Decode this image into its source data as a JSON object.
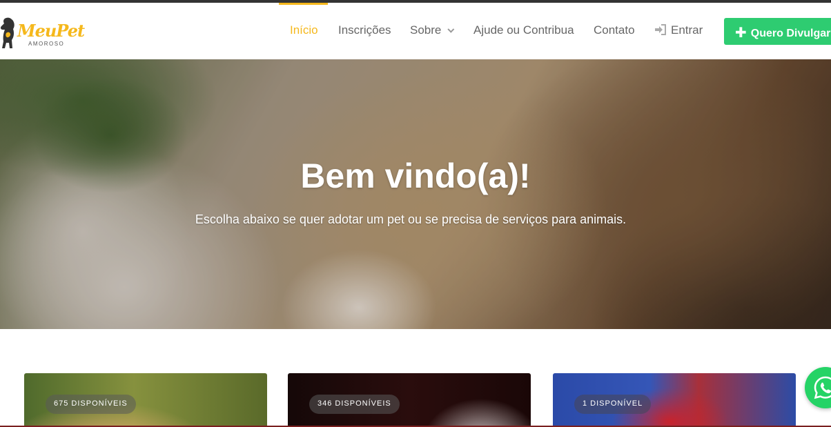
{
  "logo": {
    "name": "MeuPet",
    "tagline": "AMOROSO",
    "brand_color": "#f5b81c"
  },
  "nav": {
    "items": [
      {
        "label": "Início",
        "active": true
      },
      {
        "label": "Inscrições"
      },
      {
        "label": "Sobre",
        "has_dropdown": true
      },
      {
        "label": "Ajude ou Contribua"
      },
      {
        "label": "Contato"
      },
      {
        "label": "Entrar",
        "icon": "sign-in-icon"
      }
    ],
    "cta_label": "Quero Divulgar",
    "cta_icon": "plus-icon",
    "cta_color": "#2ecc71",
    "active_color": "#f5b81c"
  },
  "hero": {
    "title": "Bem vindo(a)!",
    "subtitle": "Escolha abaixo se quer adotar um pet ou se precisa de serviços para animais."
  },
  "cards": [
    {
      "badge": "675 DISPONÍVEIS"
    },
    {
      "badge": "346 DISPONÍVEIS"
    },
    {
      "badge": "1 DISPONÍVEL"
    }
  ],
  "floating": {
    "icon": "whatsapp-icon",
    "color": "#25d366"
  }
}
